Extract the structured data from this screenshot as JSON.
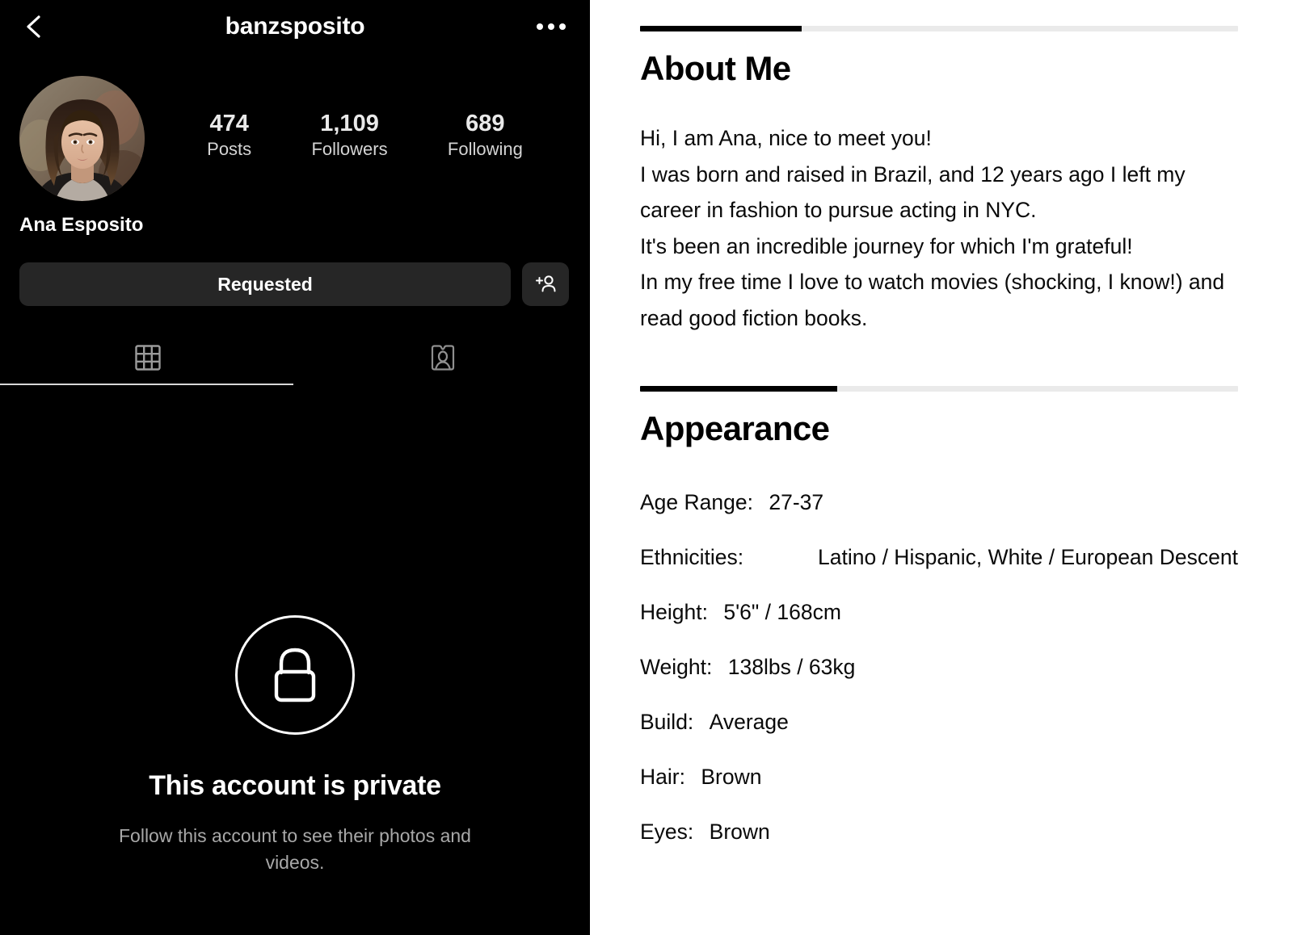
{
  "instagram": {
    "back_icon": "back-chevron-icon",
    "username": "banzsposito",
    "more_icon": "more-options-icon",
    "avatar_icon": "profile-avatar",
    "stats": [
      {
        "value": "474",
        "label": "Posts"
      },
      {
        "value": "1,109",
        "label": "Followers"
      },
      {
        "value": "689",
        "label": "Following"
      }
    ],
    "full_name": "Ana Esposito",
    "primary_button": "Requested",
    "add_user_icon": "add-person-icon",
    "tabs": [
      {
        "icon": "grid-icon",
        "active": true
      },
      {
        "icon": "tagged-id-card-icon",
        "active": false
      }
    ],
    "private": {
      "lock_icon": "lock-icon",
      "title": "This account is private",
      "subtitle": "Follow this account to see their photos and videos."
    }
  },
  "detail": {
    "about": {
      "progress_percent": 27,
      "title": "About Me",
      "bio_lines": [
        "Hi, I am Ana, nice to meet you!",
        "I was born and raised in Brazil, and 12 years ago I left my career in fashion to pursue acting in NYC.",
        "It's been an incredible journey for which I'm grateful!",
        "In my free time I love to watch movies (shocking, I know!) and read good fiction books."
      ]
    },
    "appearance": {
      "progress_percent": 33,
      "title": "Appearance",
      "attributes": [
        {
          "label": "Age Range:",
          "value": "27-37",
          "wrap": false
        },
        {
          "label": "Ethnicities:",
          "value": "Latino / Hispanic, White / European Descent",
          "wrap": true
        },
        {
          "label": "Height:",
          "value": "5'6\" / 168cm",
          "wrap": false
        },
        {
          "label": "Weight:",
          "value": "138lbs / 63kg",
          "wrap": false
        },
        {
          "label": "Build:",
          "value": "Average",
          "wrap": false
        },
        {
          "label": "Hair:",
          "value": "Brown",
          "wrap": false
        },
        {
          "label": "Eyes:",
          "value": "Brown",
          "wrap": false
        }
      ]
    }
  },
  "colors": {
    "panel_bg": "#000000",
    "detail_bg": "#ffffff",
    "button_bg": "#262626",
    "progress_fill": "#000000",
    "progress_track": "#eaeaea",
    "muted_text": "#a8a8a8"
  }
}
